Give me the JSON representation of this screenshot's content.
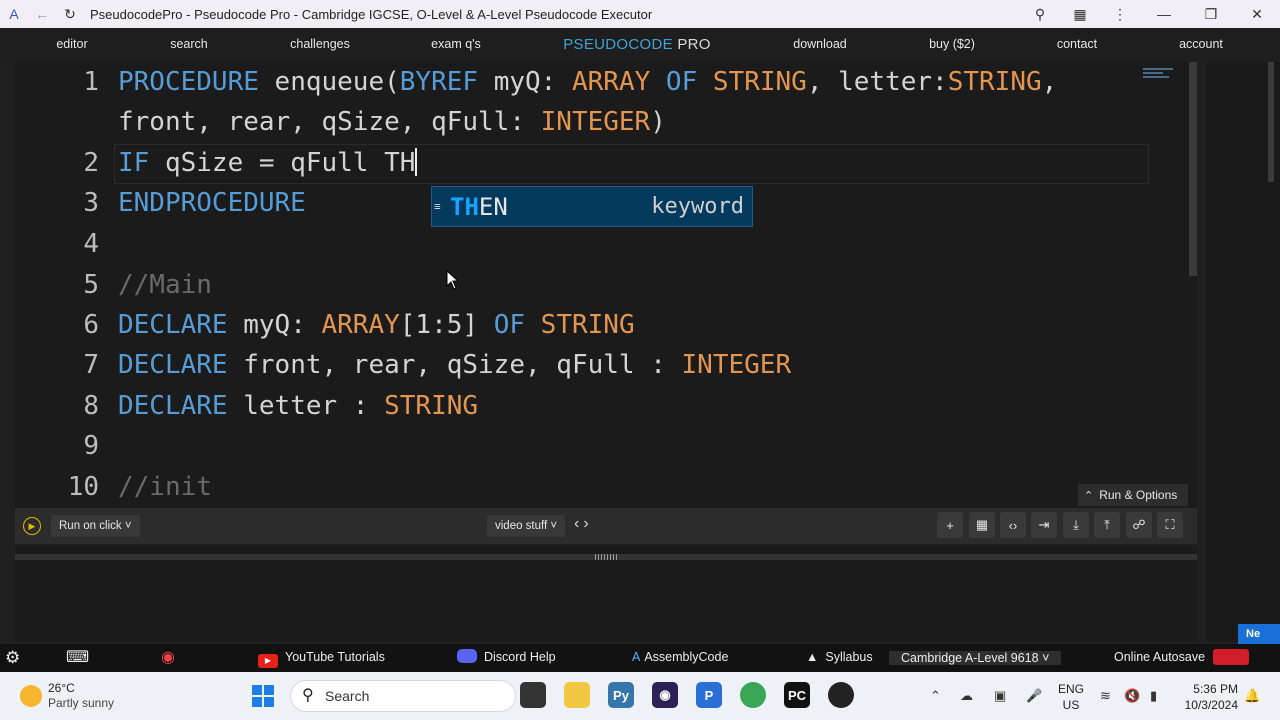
{
  "browser": {
    "title": "PseudocodePro - Pseudocode Pro - Cambridge IGCSE, O-Level & A-Level Pseudocode Executor",
    "icons": [
      "back-arrow-icon",
      "reload-icon",
      "zoom-icon",
      "extensions-icon",
      "menu-dots-icon",
      "minimize-icon",
      "restore-icon",
      "close-icon"
    ]
  },
  "nav": {
    "editor": "editor",
    "search": "search",
    "challenges": "challenges",
    "exam": "exam q's",
    "brand_part1": "PSEUDOCODE",
    "brand_part2": "PRO",
    "download": "download",
    "buy": "buy ($2)",
    "contact": "contact",
    "account": "account"
  },
  "editor": {
    "line_numbers": [
      "1",
      "2",
      "3",
      "4",
      "5",
      "6",
      "7",
      "8",
      "9",
      "10"
    ],
    "cursor_line": 2,
    "colors": {
      "keyword": "#569cd6",
      "type": "#e39552",
      "comment": "#6a6a6a",
      "text": "#d4d4d4"
    }
  },
  "code": {
    "l1a": "PROCEDURE",
    "l1b": " enqueue(",
    "l1c": "BYREF",
    "l1d": " myQ: ",
    "l1e": "ARRAY",
    "l1f": " ",
    "l1g": "OF",
    "l1h": " ",
    "l1i": "STRING",
    "l1j": ", letter:",
    "l1k": "STRING",
    "l1l": ",",
    "l1w1": "front, rear, qSize, qFull: ",
    "l1w2": "INTEGER",
    "l1w3": ")",
    "l2a": "IF",
    "l2b": " qSize = qFull TH",
    "l3a": "ENDPROCEDURE",
    "l5a": "//Main",
    "l6a": "DECLARE",
    "l6b": " myQ: ",
    "l6c": "ARRAY",
    "l6d": "[1:5] ",
    "l6e": "OF",
    "l6f": " ",
    "l6g": "STRING",
    "l7a": "DECLARE",
    "l7b": " front, rear, qSize, qFull : ",
    "l7c": "INTEGER",
    "l8a": "DECLARE",
    "l8b": " letter : ",
    "l8c": "STRING",
    "l10a": "//init"
  },
  "autocomplete": {
    "match": "TH",
    "rest": "EN",
    "kind": "keyword",
    "icon": "keyword-icon"
  },
  "run_options": {
    "label": "Run & Options"
  },
  "toolbar": {
    "run_mode": "Run on click",
    "preset": "video stuff",
    "icons": [
      "add-icon",
      "table-icon",
      "code-icon",
      "import-icon",
      "download-icon",
      "upload-icon",
      "share-icon",
      "fullscreen-icon"
    ]
  },
  "new_badge": "Ne",
  "appbar": {
    "youtube": "YouTube Tutorials",
    "discord": "Discord Help",
    "assembly": "AssemblyCode",
    "syllabus": "Syllabus",
    "syllabus_select": "Cambridge A-Level 9618",
    "autosave": "Online Autosave",
    "autosave_color": "#d21d2a"
  },
  "taskbar": {
    "temperature": "26°C",
    "weather": "Partly sunny",
    "search_placeholder": "Search",
    "lang1": "ENG",
    "lang2": "US",
    "time": "5:36 PM",
    "date": "10/3/2024"
  }
}
